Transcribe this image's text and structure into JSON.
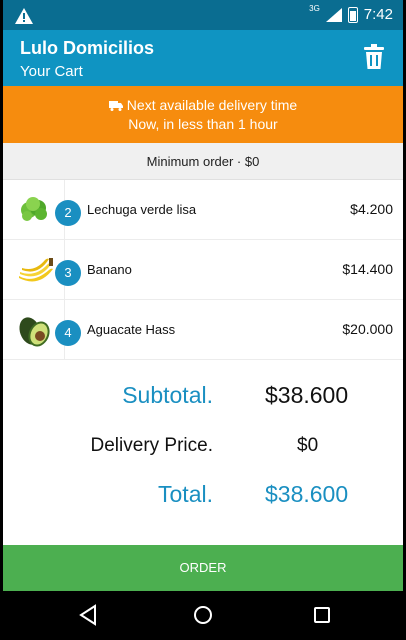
{
  "status_bar": {
    "network": "3G",
    "time": "7:42"
  },
  "app_bar": {
    "title": "Lulo Domicilios",
    "subtitle": "Your Cart"
  },
  "banner": {
    "line1": "Next available delivery time",
    "line2": "Now, in less than 1 hour"
  },
  "min_order": "Minimum order · $0",
  "cart": {
    "items": [
      {
        "qty": "2",
        "name": "Lechuga verde lisa",
        "price": "$4.200",
        "icon": "lettuce-icon"
      },
      {
        "qty": "3",
        "name": "Banano",
        "price": "$14.400",
        "icon": "banana-icon"
      },
      {
        "qty": "4",
        "name": "Aguacate Hass",
        "price": "$20.000",
        "icon": "avocado-icon"
      }
    ]
  },
  "summary": {
    "subtotal_label": "Subtotal.",
    "subtotal_value": "$38.600",
    "delivery_label": "Delivery Price.",
    "delivery_value": "$0",
    "total_label": "Total.",
    "total_value": "$38.600"
  },
  "order_button": "ORDER",
  "colors": {
    "status_bar": "#0a6d91",
    "app_bar": "#0f94c2",
    "banner": "#f68c0e",
    "accent": "#1a8fc1",
    "order_button": "#4caf50"
  }
}
